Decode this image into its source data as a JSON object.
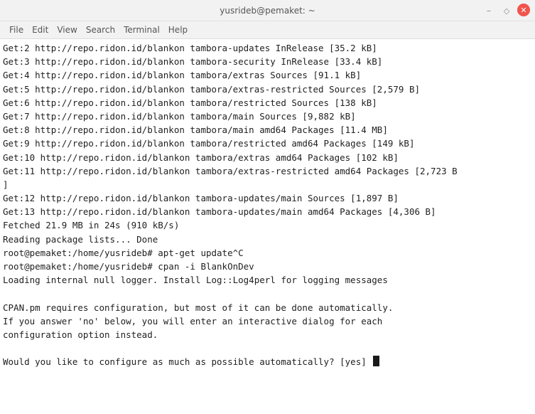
{
  "window": {
    "title": "yusrideb@pemaket: ~",
    "controls": {
      "minimize_glyph": "–",
      "maximize_glyph": "◇",
      "close_glyph": "✕"
    },
    "close_color": "#f0544c"
  },
  "menubar": {
    "items": [
      "File",
      "Edit",
      "View",
      "Search",
      "Terminal",
      "Help"
    ]
  },
  "terminal": {
    "lines": [
      "Get:2 http://repo.ridon.id/blankon tambora-updates InRelease [35.2 kB]",
      "Get:3 http://repo.ridon.id/blankon tambora-security InRelease [33.4 kB]",
      "Get:4 http://repo.ridon.id/blankon tambora/extras Sources [91.1 kB]",
      "Get:5 http://repo.ridon.id/blankon tambora/extras-restricted Sources [2,579 B]",
      "Get:6 http://repo.ridon.id/blankon tambora/restricted Sources [138 kB]",
      "Get:7 http://repo.ridon.id/blankon tambora/main Sources [9,882 kB]",
      "Get:8 http://repo.ridon.id/blankon tambora/main amd64 Packages [11.4 MB]",
      "Get:9 http://repo.ridon.id/blankon tambora/restricted amd64 Packages [149 kB]",
      "Get:10 http://repo.ridon.id/blankon tambora/extras amd64 Packages [102 kB]",
      "Get:11 http://repo.ridon.id/blankon tambora/extras-restricted amd64 Packages [2,723 B",
      "]",
      "Get:12 http://repo.ridon.id/blankon tambora-updates/main Sources [1,897 B]",
      "Get:13 http://repo.ridon.id/blankon tambora-updates/main amd64 Packages [4,306 B]",
      "Fetched 21.9 MB in 24s (910 kB/s)",
      "Reading package lists... Done",
      "root@pemaket:/home/yusrideb# apt-get update^C",
      "root@pemaket:/home/yusrideb# cpan -i BlankOnDev",
      "Loading internal null logger. Install Log::Log4perl for logging messages",
      "",
      "CPAN.pm requires configuration, but most of it can be done automatically.",
      "If you answer 'no' below, you will enter an interactive dialog for each",
      "configuration option instead.",
      "",
      "Would you like to configure as much as possible automatically? [yes] "
    ]
  }
}
